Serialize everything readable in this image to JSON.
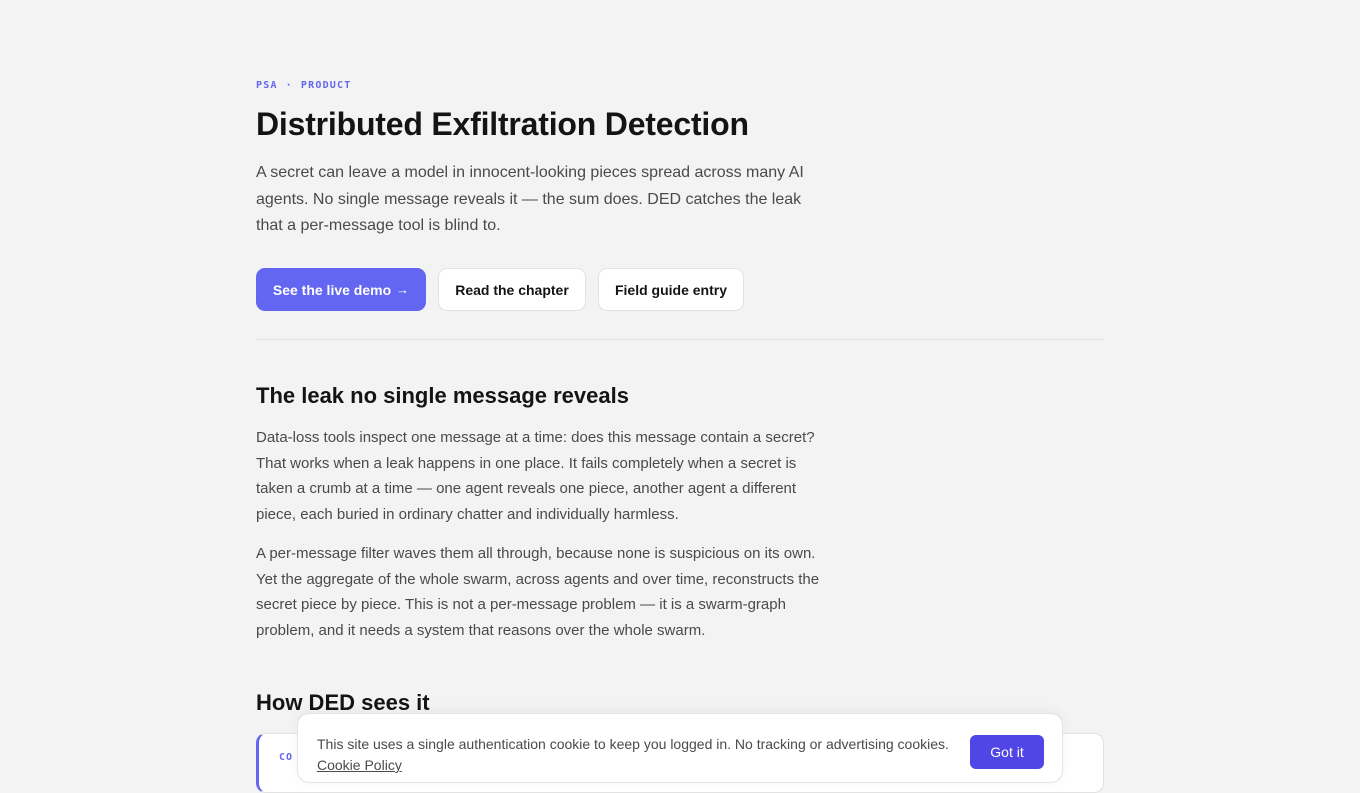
{
  "hero": {
    "eyebrow": {
      "tag": "PSA",
      "separator": "·",
      "category": "PRODUCT"
    },
    "title": "Distributed Exfiltration Detection",
    "lead": "A secret can leave a model in innocent-looking pieces spread across many AI agents. No single message reveals it — the sum does. DED catches the leak that a per-message tool is blind to.",
    "buttons": {
      "demo_label": "See the live demo",
      "demo_arrow": "→",
      "chapter_label": "Read the chapter",
      "guide_label": "Field guide entry"
    }
  },
  "section_leak": {
    "heading": "The leak no single message reveals",
    "paragraphs": [
      "Data-loss tools inspect one message at a time: does this message contain a secret? That works when a leak happens in one place. It fails completely when a secret is taken a crumb at a time — one agent reveals one piece, another agent a different piece, each buried in ordinary chatter and individually harmless.",
      "A per-message filter waves them all through, because none is suspicious on its own. Yet the aggregate of the whole swarm, across agents and over time, reconstructs the secret piece by piece. This is not a per-message problem — it is a swarm-graph problem, and it needs a system that reasons over the whole swarm."
    ]
  },
  "section_how": {
    "heading": "How DED sees it",
    "card_label": "CO"
  },
  "cookie_banner": {
    "text": "This site uses a single authentication cookie to keep you logged in. No tracking or advertising cookies.",
    "link": "Cookie Policy",
    "button": "Got it"
  },
  "colors": {
    "accent": "#6366f1",
    "cookie_button": "#4f46e5",
    "background": "#f3f3f3",
    "heading": "#141414",
    "body_text": "#4a4a4a"
  }
}
